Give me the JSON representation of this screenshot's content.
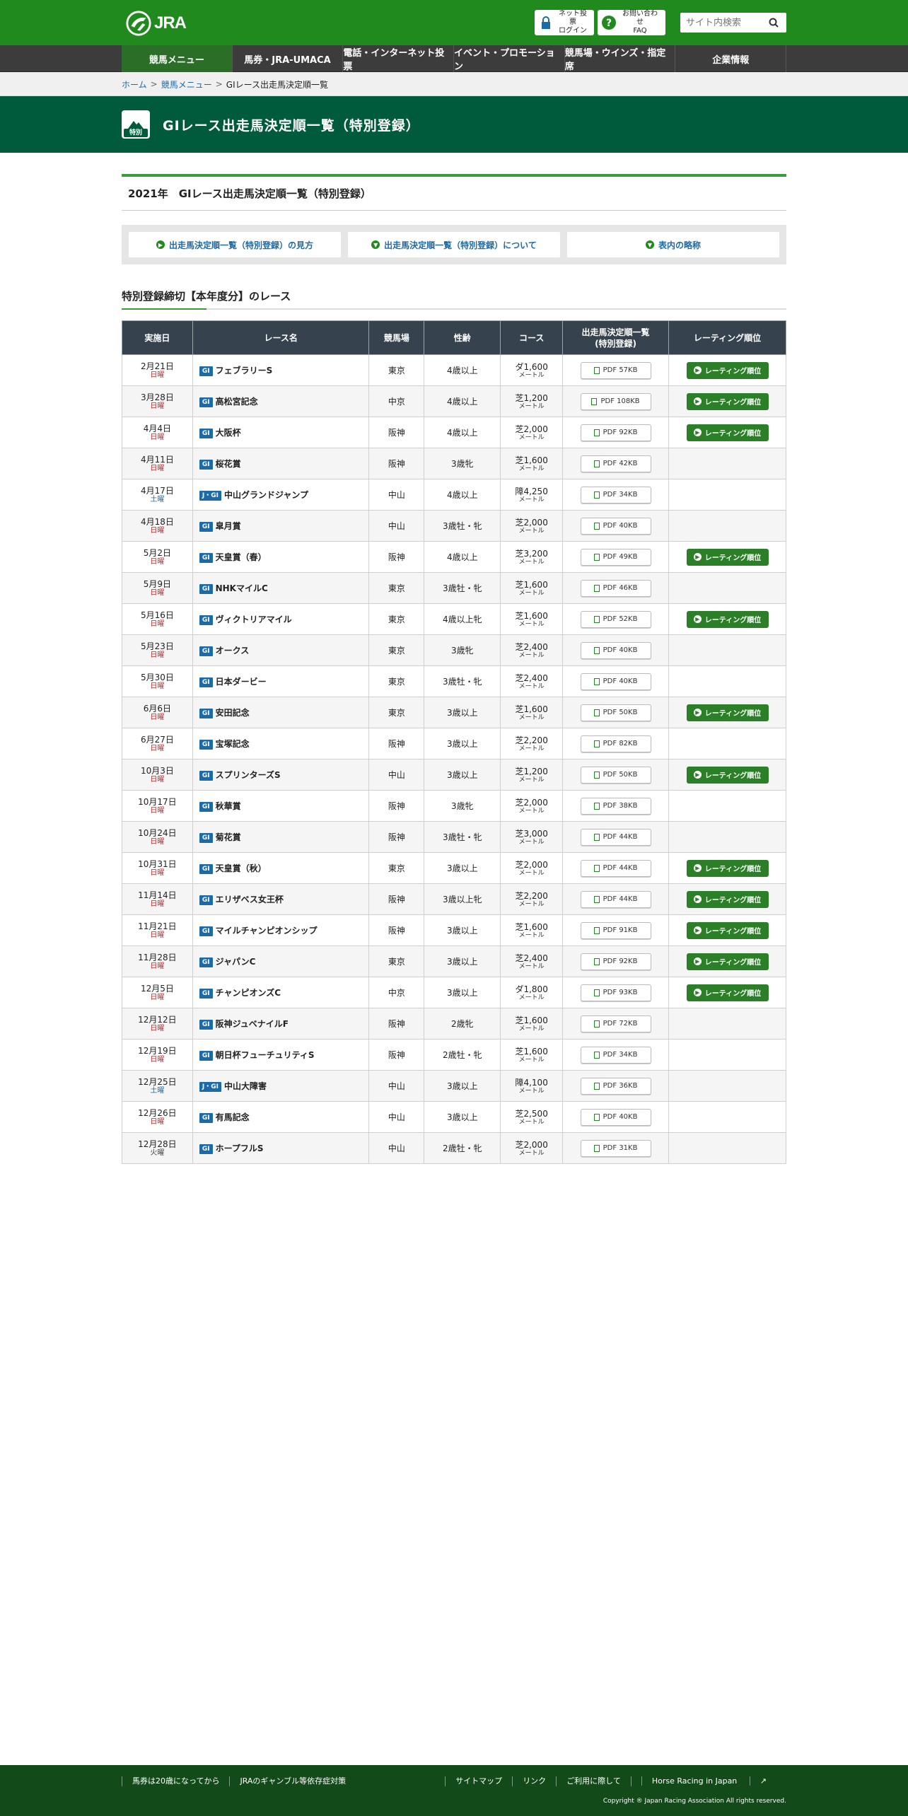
{
  "header": {
    "logo_text": "JRA",
    "login_line1": "ネット投票",
    "login_line2": "ログイン",
    "faq_line1": "お問い合わせ",
    "faq_line2": "FAQ",
    "search_placeholder": "サイト内検索"
  },
  "nav": [
    "競馬メニュー",
    "馬券・JRA-UMACA",
    "電話・インターネット投票",
    "イベント・プロモーション",
    "競馬場・ウインズ・指定席",
    "企業情報"
  ],
  "breadcrumb": {
    "home": "ホーム",
    "menu": "競馬メニュー",
    "current": "GⅠレース出走馬決定順一覧"
  },
  "page_title": "GⅠレース出走馬決定順一覧（特別登録）",
  "title_icon_label": "特別",
  "section_title": "2021年　GⅠレース出走馬決定順一覧（特別登録）",
  "links": [
    "出走馬決定順一覧（特別登録）の見方",
    "出走馬決定順一覧（特別登録）について",
    "表内の略称"
  ],
  "subsection_title": "特別登録締切【本年度分】のレース",
  "table": {
    "headers": [
      "実施日",
      "レース名",
      "競馬場",
      "性齢",
      "コース",
      "出走馬決定順一覧\n(特別登録)",
      "レーティング順位"
    ],
    "rating_label": "レーティング順位",
    "rows": [
      {
        "date": "2月21日",
        "dow": "日曜",
        "grade": "GⅠ",
        "name": "フェブラリーS",
        "venue": "東京",
        "age": "4歳以上",
        "course": "ダ1,600",
        "unit": "メートル",
        "pdf": "PDF 57KB",
        "rating": true
      },
      {
        "date": "3月28日",
        "dow": "日曜",
        "grade": "GⅠ",
        "name": "高松宮記念",
        "venue": "中京",
        "age": "4歳以上",
        "course": "芝1,200",
        "unit": "メートル",
        "pdf": "PDF 108KB",
        "rating": true
      },
      {
        "date": "4月4日",
        "dow": "日曜",
        "grade": "GⅠ",
        "name": "大阪杯",
        "venue": "阪神",
        "age": "4歳以上",
        "course": "芝2,000",
        "unit": "メートル",
        "pdf": "PDF 92KB",
        "rating": true
      },
      {
        "date": "4月11日",
        "dow": "日曜",
        "grade": "GⅠ",
        "name": "桜花賞",
        "venue": "阪神",
        "age": "3歳牝",
        "course": "芝1,600",
        "unit": "メートル",
        "pdf": "PDF 42KB",
        "rating": false
      },
      {
        "date": "4月17日",
        "dow": "土曜",
        "grade": "J・GⅠ",
        "name": "中山グランドジャンプ",
        "venue": "中山",
        "age": "4歳以上",
        "course": "障4,250",
        "unit": "メートル",
        "pdf": "PDF 34KB",
        "rating": false
      },
      {
        "date": "4月18日",
        "dow": "日曜",
        "grade": "GⅠ",
        "name": "皐月賞",
        "venue": "中山",
        "age": "3歳牡・牝",
        "course": "芝2,000",
        "unit": "メートル",
        "pdf": "PDF 40KB",
        "rating": false
      },
      {
        "date": "5月2日",
        "dow": "日曜",
        "grade": "GⅠ",
        "name": "天皇賞（春）",
        "venue": "阪神",
        "age": "4歳以上",
        "course": "芝3,200",
        "unit": "メートル",
        "pdf": "PDF 49KB",
        "rating": true
      },
      {
        "date": "5月9日",
        "dow": "日曜",
        "grade": "GⅠ",
        "name": "NHKマイルC",
        "venue": "東京",
        "age": "3歳牡・牝",
        "course": "芝1,600",
        "unit": "メートル",
        "pdf": "PDF 46KB",
        "rating": false
      },
      {
        "date": "5月16日",
        "dow": "日曜",
        "grade": "GⅠ",
        "name": "ヴィクトリアマイル",
        "venue": "東京",
        "age": "4歳以上牝",
        "course": "芝1,600",
        "unit": "メートル",
        "pdf": "PDF 52KB",
        "rating": true
      },
      {
        "date": "5月23日",
        "dow": "日曜",
        "grade": "GⅠ",
        "name": "オークス",
        "venue": "東京",
        "age": "3歳牝",
        "course": "芝2,400",
        "unit": "メートル",
        "pdf": "PDF 40KB",
        "rating": false
      },
      {
        "date": "5月30日",
        "dow": "日曜",
        "grade": "GⅠ",
        "name": "日本ダービー",
        "venue": "東京",
        "age": "3歳牡・牝",
        "course": "芝2,400",
        "unit": "メートル",
        "pdf": "PDF 40KB",
        "rating": false
      },
      {
        "date": "6月6日",
        "dow": "日曜",
        "grade": "GⅠ",
        "name": "安田記念",
        "venue": "東京",
        "age": "3歳以上",
        "course": "芝1,600",
        "unit": "メートル",
        "pdf": "PDF 50KB",
        "rating": true
      },
      {
        "date": "6月27日",
        "dow": "日曜",
        "grade": "GⅠ",
        "name": "宝塚記念",
        "venue": "阪神",
        "age": "3歳以上",
        "course": "芝2,200",
        "unit": "メートル",
        "pdf": "PDF 82KB",
        "rating": false
      },
      {
        "date": "10月3日",
        "dow": "日曜",
        "grade": "GⅠ",
        "name": "スプリンターズS",
        "venue": "中山",
        "age": "3歳以上",
        "course": "芝1,200",
        "unit": "メートル",
        "pdf": "PDF 50KB",
        "rating": true
      },
      {
        "date": "10月17日",
        "dow": "日曜",
        "grade": "GⅠ",
        "name": "秋華賞",
        "venue": "阪神",
        "age": "3歳牝",
        "course": "芝2,000",
        "unit": "メートル",
        "pdf": "PDF 38KB",
        "rating": false
      },
      {
        "date": "10月24日",
        "dow": "日曜",
        "grade": "GⅠ",
        "name": "菊花賞",
        "venue": "阪神",
        "age": "3歳牡・牝",
        "course": "芝3,000",
        "unit": "メートル",
        "pdf": "PDF 44KB",
        "rating": false
      },
      {
        "date": "10月31日",
        "dow": "日曜",
        "grade": "GⅠ",
        "name": "天皇賞（秋）",
        "venue": "東京",
        "age": "3歳以上",
        "course": "芝2,000",
        "unit": "メートル",
        "pdf": "PDF 44KB",
        "rating": true
      },
      {
        "date": "11月14日",
        "dow": "日曜",
        "grade": "GⅠ",
        "name": "エリザベス女王杯",
        "venue": "阪神",
        "age": "3歳以上牝",
        "course": "芝2,200",
        "unit": "メートル",
        "pdf": "PDF 44KB",
        "rating": true
      },
      {
        "date": "11月21日",
        "dow": "日曜",
        "grade": "GⅠ",
        "name": "マイルチャンピオンシップ",
        "venue": "阪神",
        "age": "3歳以上",
        "course": "芝1,600",
        "unit": "メートル",
        "pdf": "PDF 91KB",
        "rating": true
      },
      {
        "date": "11月28日",
        "dow": "日曜",
        "grade": "GⅠ",
        "name": "ジャパンC",
        "venue": "東京",
        "age": "3歳以上",
        "course": "芝2,400",
        "unit": "メートル",
        "pdf": "PDF 92KB",
        "rating": true
      },
      {
        "date": "12月5日",
        "dow": "日曜",
        "grade": "GⅠ",
        "name": "チャンピオンズC",
        "venue": "中京",
        "age": "3歳以上",
        "course": "ダ1,800",
        "unit": "メートル",
        "pdf": "PDF 93KB",
        "rating": true
      },
      {
        "date": "12月12日",
        "dow": "日曜",
        "grade": "GⅠ",
        "name": "阪神ジュベナイルF",
        "venue": "阪神",
        "age": "2歳牝",
        "course": "芝1,600",
        "unit": "メートル",
        "pdf": "PDF 72KB",
        "rating": false
      },
      {
        "date": "12月19日",
        "dow": "日曜",
        "grade": "GⅠ",
        "name": "朝日杯フューチュリティS",
        "venue": "阪神",
        "age": "2歳牡・牝",
        "course": "芝1,600",
        "unit": "メートル",
        "pdf": "PDF 34KB",
        "rating": false
      },
      {
        "date": "12月25日",
        "dow": "土曜",
        "grade": "J・GⅠ",
        "name": "中山大障害",
        "venue": "中山",
        "age": "3歳以上",
        "course": "障4,100",
        "unit": "メートル",
        "pdf": "PDF 36KB",
        "rating": false
      },
      {
        "date": "12月26日",
        "dow": "日曜",
        "grade": "GⅠ",
        "name": "有馬記念",
        "venue": "中山",
        "age": "3歳以上",
        "course": "芝2,500",
        "unit": "メートル",
        "pdf": "PDF 40KB",
        "rating": false
      },
      {
        "date": "12月28日",
        "dow": "火曜",
        "grade": "GⅠ",
        "name": "ホープフルS",
        "venue": "中山",
        "age": "2歳牡・牝",
        "course": "芝2,000",
        "unit": "メートル",
        "pdf": "PDF 31KB",
        "rating": false
      }
    ]
  },
  "footer": {
    "left_links": [
      "馬券は20歳になってから",
      "JRAのギャンブル等依存症対策"
    ],
    "right_links": [
      "サイトマップ",
      "リンク",
      "ご利用に際して",
      "Horse Racing in Japan"
    ],
    "copyright": "Copyright ® Japan Racing Association All rights reserved."
  },
  "colors": {
    "header_green": "#218a1e",
    "title_dark_green": "#005a3c",
    "nav_dark": "#3c3c3c",
    "grade_blue": "#1c6aa8",
    "rating_green": "#2a7f27",
    "sunday_red": "#c1272d",
    "saturday_blue": "#1c6aa8",
    "footer_green": "#124b19"
  }
}
